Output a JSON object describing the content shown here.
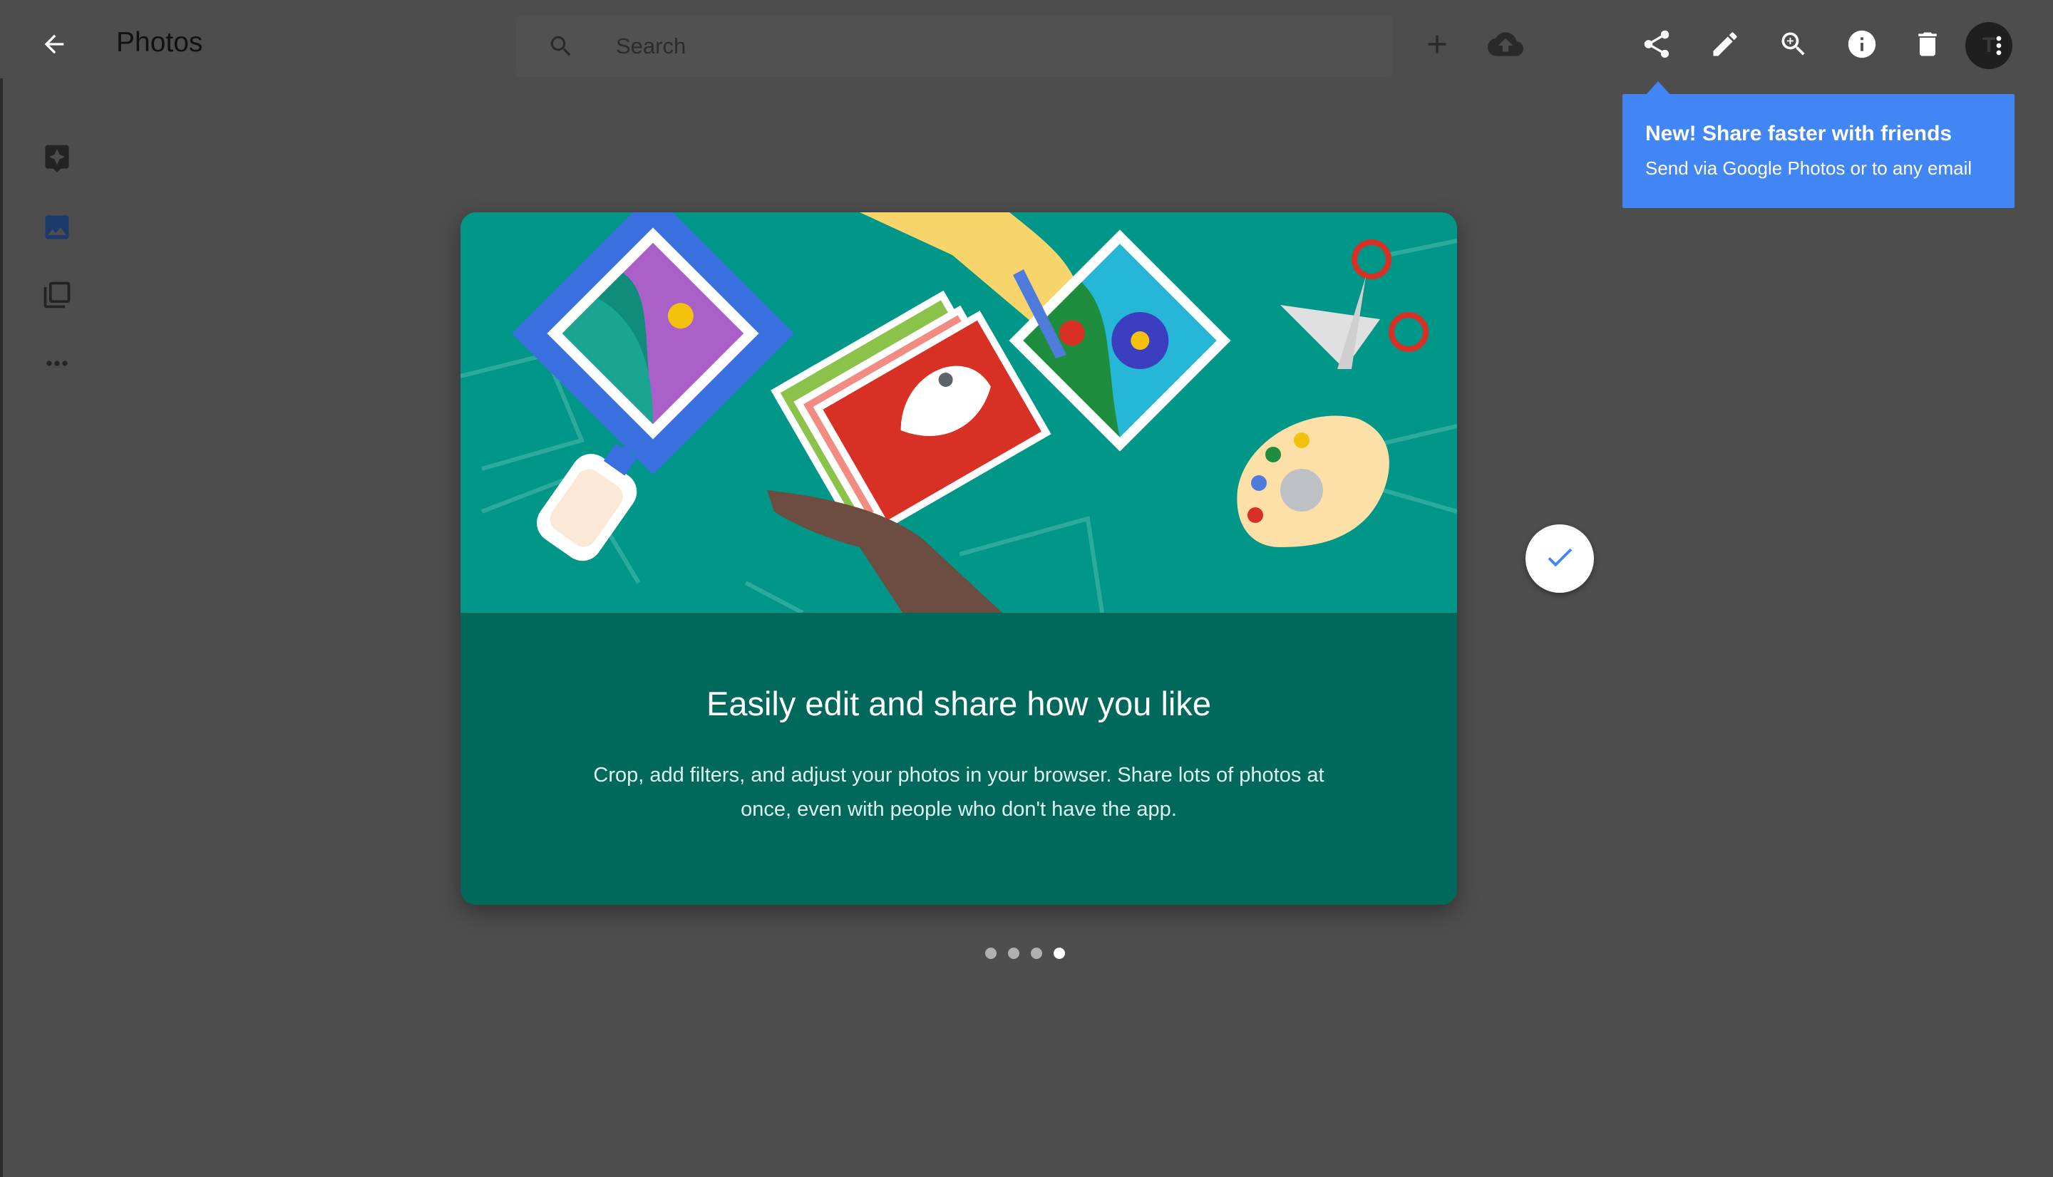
{
  "header": {
    "back_icon": "arrow-back-icon",
    "title": "Photos",
    "search": {
      "placeholder": "Search",
      "value": ""
    },
    "actions": [
      "add-icon",
      "upload-cloud-icon",
      "share-icon",
      "edit-pencil-icon",
      "zoom-in-icon",
      "info-icon",
      "delete-icon",
      "more-vert-icon"
    ],
    "avatar_letter": "T"
  },
  "sidebar": {
    "items": [
      {
        "name": "assistant",
        "icon": "assistant-sparkle-icon"
      },
      {
        "name": "photos",
        "icon": "photo-icon",
        "active": true
      },
      {
        "name": "albums",
        "icon": "albums-icon"
      },
      {
        "name": "more",
        "icon": "more-horiz-icon"
      }
    ]
  },
  "tooltip": {
    "title": "New! Share faster with friends",
    "subtitle": "Send via Google Photos or to any email"
  },
  "onboarding": {
    "title": "Easily edit and share how you like",
    "description": "Crop, add filters, and adjust your photos in your browser. Share lots of photos at once, even with people who don't have the app.",
    "confirm_icon": "check-icon",
    "pages": 4,
    "current_page": 4
  },
  "colors": {
    "background": "#4d4d4d",
    "card_top": "#009688",
    "card_bottom": "#00695c",
    "tooltip": "#4285f4",
    "check": "#4285f4"
  }
}
